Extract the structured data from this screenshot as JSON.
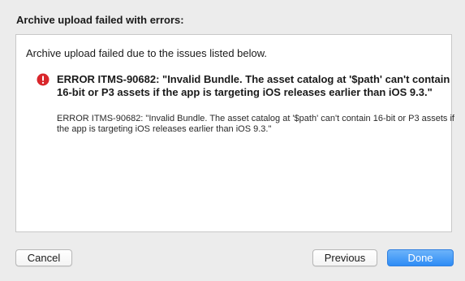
{
  "dialog": {
    "title": "Archive upload failed with errors:",
    "summary": "Archive upload failed due to the issues listed below.",
    "issues": [
      {
        "icon": "error-icon",
        "title": "ERROR ITMS-90682: \"Invalid Bundle. The asset catalog at '$path' can't contain 16-bit or P3 assets if the app is targeting iOS releases earlier than iOS 9.3.\"",
        "detail": "ERROR ITMS-90682: \"Invalid Bundle. The asset catalog at '$path' can't contain 16-bit or P3 assets if the app is targeting iOS releases earlier than iOS 9.3.\""
      }
    ]
  },
  "buttons": {
    "cancel_label": "Cancel",
    "previous_label": "Previous",
    "done_label": "Done"
  },
  "colors": {
    "error_red": "#d9262b",
    "primary_blue": "#2e8cf5",
    "window_background": "#ececec"
  }
}
